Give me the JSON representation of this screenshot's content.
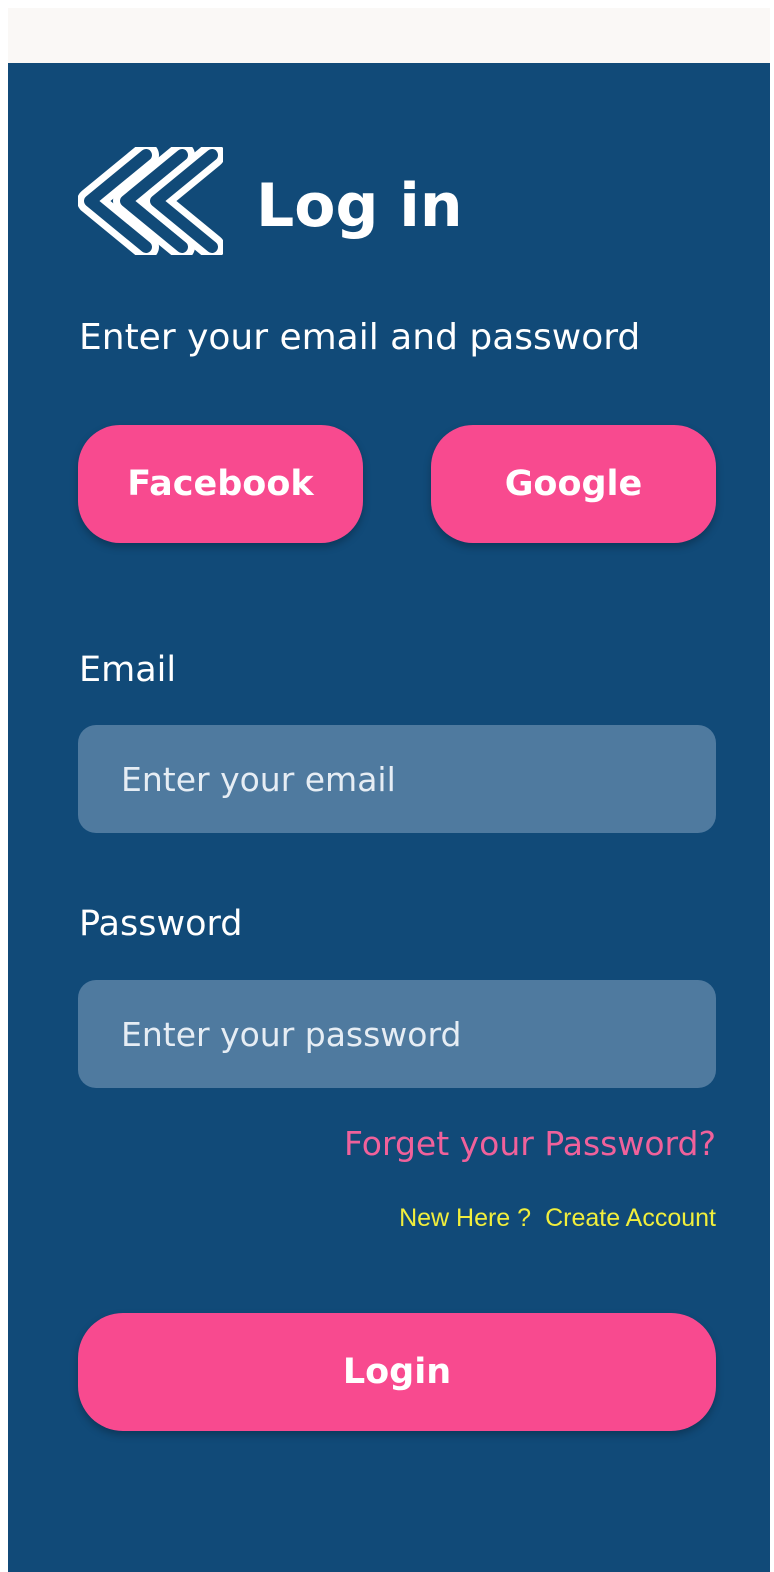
{
  "header": {
    "back_icon": "double-chevron-left-icon",
    "title": "Log in",
    "subtitle": "Enter your email and password"
  },
  "social": {
    "facebook_label": "Facebook",
    "google_label": "Google"
  },
  "form": {
    "email_label": "Email",
    "email_placeholder": "Enter your email",
    "email_value": "",
    "password_label": "Password",
    "password_placeholder": "Enter your password",
    "password_value": ""
  },
  "links": {
    "forgot_password": "Forget your Password?",
    "new_here": "New Here ?",
    "create_account": "Create Account"
  },
  "actions": {
    "login_label": "Login"
  },
  "colors": {
    "background": "#114a78",
    "accent": "#f84a8f",
    "input_background": "#4f7a9f",
    "link_pink": "#f0619b",
    "link_yellow": "#f1ee3c",
    "text": "#ffffff"
  }
}
